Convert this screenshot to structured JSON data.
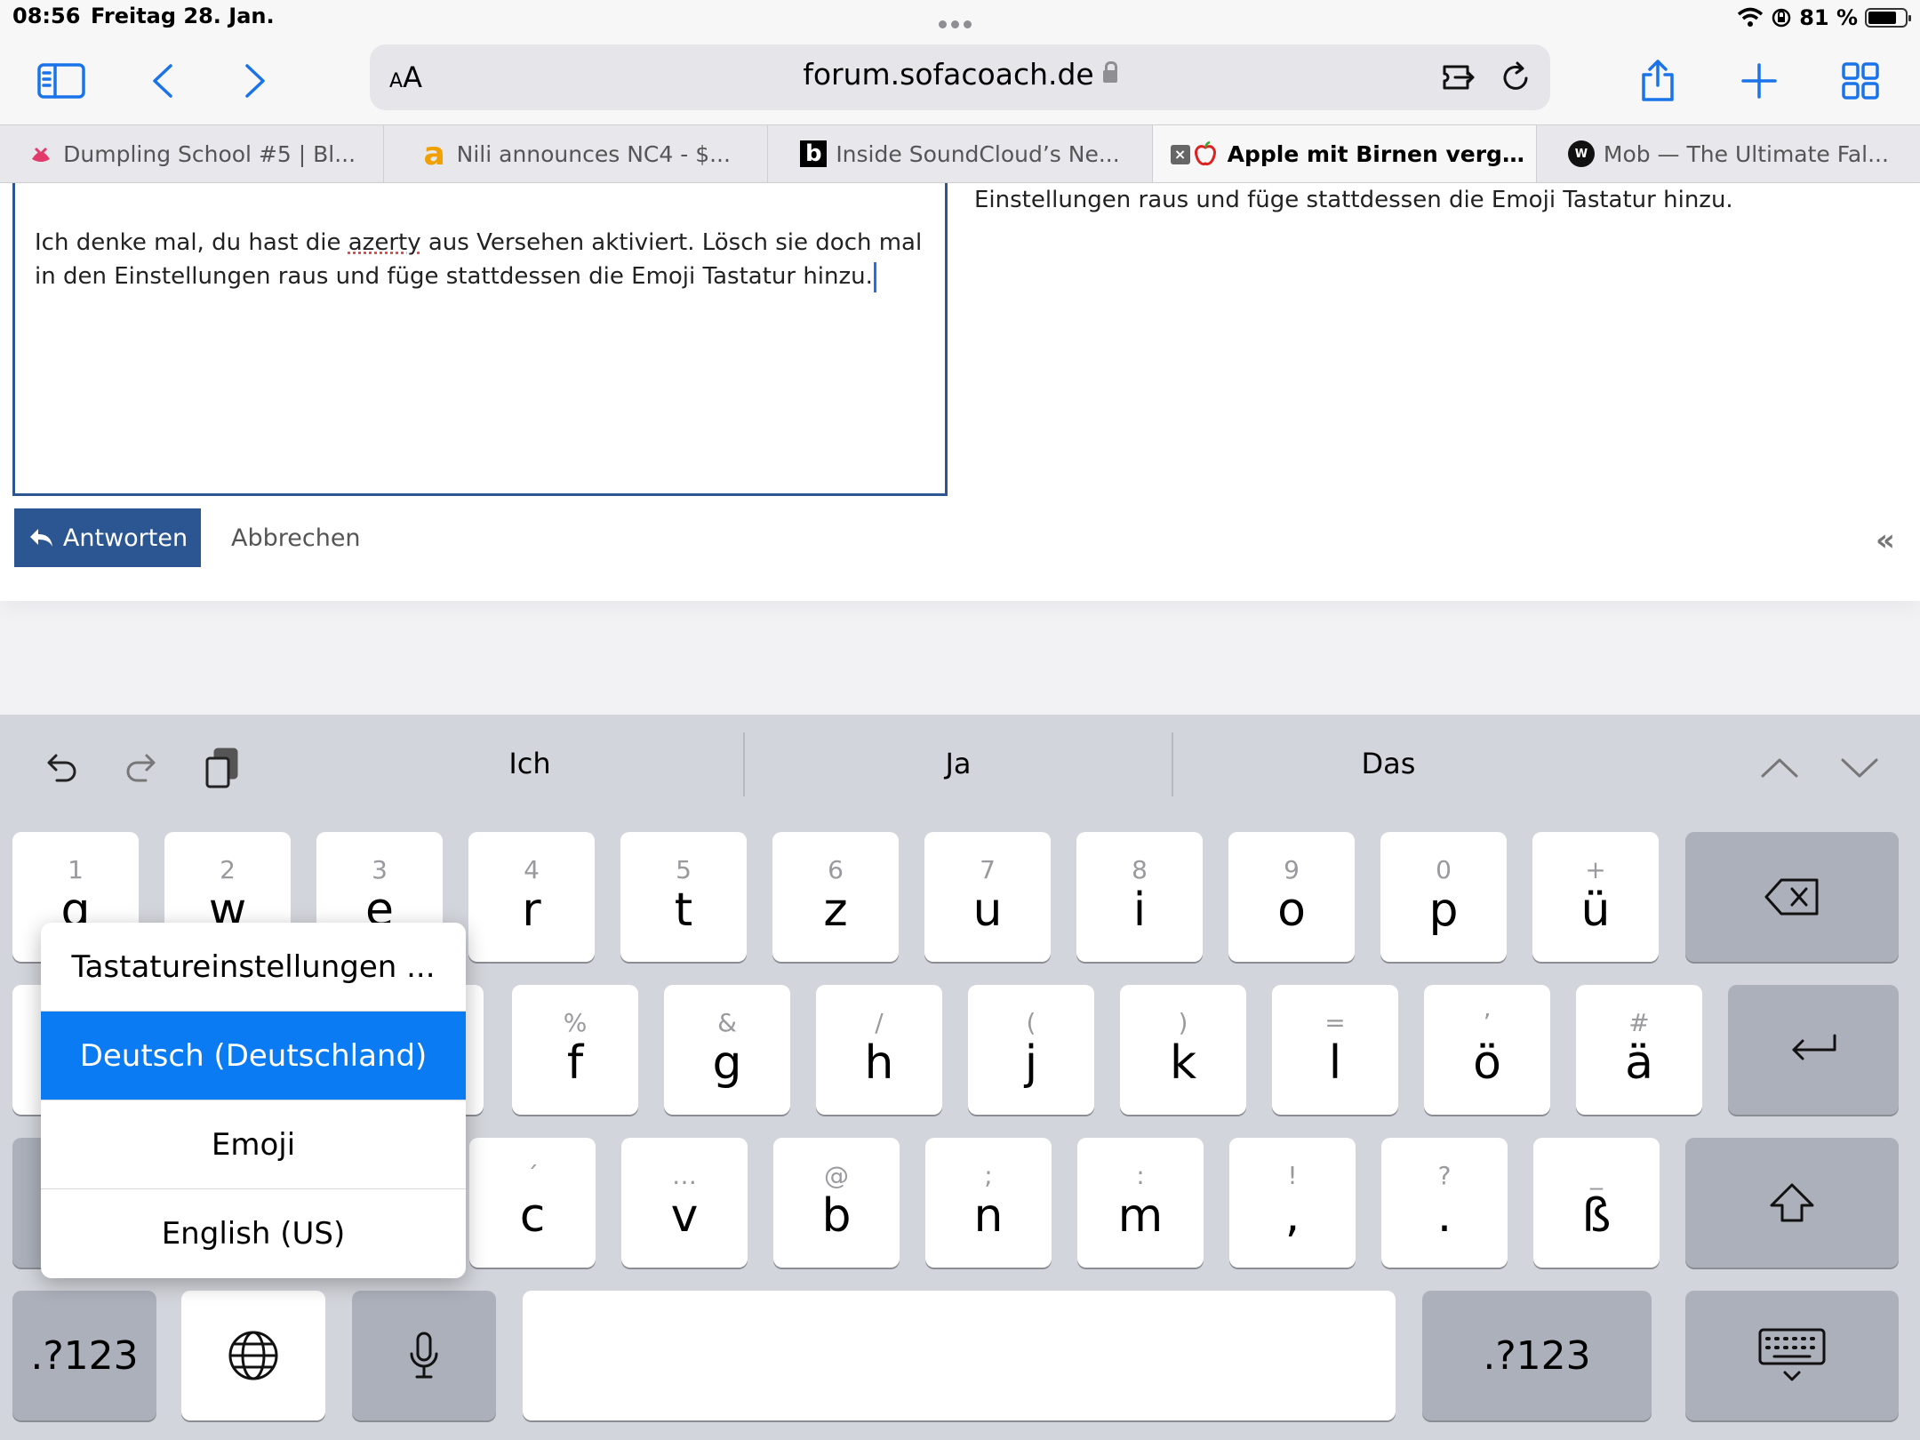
{
  "status": {
    "time": "08:56",
    "date": "Freitag 28. Jan.",
    "battery": "81 %"
  },
  "browser": {
    "aa_small": "A",
    "aa_big": "A",
    "url": "forum.sofacoach.de"
  },
  "tabs": [
    {
      "label": "Dumpling School #5 | Bl...",
      "favicon": "dumpling-icon",
      "active": false
    },
    {
      "label": "Nili announces NC4 - $...",
      "favicon": "amazon-icon",
      "active": false
    },
    {
      "label": "Inside SoundCloud’s Ne...",
      "favicon": "b-icon",
      "active": false
    },
    {
      "label": "Apple mit Birnen vergle...",
      "favicon": "apple-icon",
      "active": true
    },
    {
      "label": "Mob — The Ultimate Fal...",
      "favicon": "wm-icon",
      "active": false
    }
  ],
  "page": {
    "editor_text_1": "Ich denke mal, du hast die ",
    "editor_spell": "azerty",
    "editor_text_2": " aus Versehen aktiviert. Lösch sie doch mal in den Einstellungen raus und füge stattdessen die Emoji Tastatur hinzu.",
    "preview_text": "Einstellungen raus und füge stattdessen die Emoji Tastatur hinzu.",
    "reply_label": "Antworten",
    "cancel_label": "Abbrechen",
    "collapse": "«"
  },
  "keyboard": {
    "suggestions": [
      "Ich",
      "Ja",
      "Das"
    ],
    "row1": [
      {
        "alt": "1",
        "main": "q"
      },
      {
        "alt": "2",
        "main": "w"
      },
      {
        "alt": "3",
        "main": "e"
      },
      {
        "alt": "4",
        "main": "r"
      },
      {
        "alt": "5",
        "main": "t"
      },
      {
        "alt": "6",
        "main": "z"
      },
      {
        "alt": "7",
        "main": "u"
      },
      {
        "alt": "8",
        "main": "i"
      },
      {
        "alt": "9",
        "main": "o"
      },
      {
        "alt": "0",
        "main": "p"
      },
      {
        "alt": "+",
        "main": "ü"
      }
    ],
    "row2": [
      {
        "alt": "%",
        "main": "f"
      },
      {
        "alt": "&",
        "main": "g"
      },
      {
        "alt": "/",
        "main": "h"
      },
      {
        "alt": "(",
        "main": "j"
      },
      {
        "alt": ")",
        "main": "k"
      },
      {
        "alt": "=",
        "main": "l"
      },
      {
        "alt": "’",
        "main": "ö"
      },
      {
        "alt": "#",
        "main": "ä"
      }
    ],
    "row3": [
      {
        "alt": "´",
        "main": "c"
      },
      {
        "alt": "…",
        "main": "v"
      },
      {
        "alt": "@",
        "main": "b"
      },
      {
        "alt": ";",
        "main": "n"
      },
      {
        "alt": ":",
        "main": "m"
      },
      {
        "alt": "!",
        "main": ","
      },
      {
        "alt": "?",
        "main": "."
      },
      {
        "alt": "_",
        "main": "ß"
      }
    ],
    "numbers_label": ".?123",
    "popup": [
      "Tastatureinstellungen ...",
      "Deutsch (Deutschland)",
      "Emoji",
      "English (US)"
    ]
  }
}
